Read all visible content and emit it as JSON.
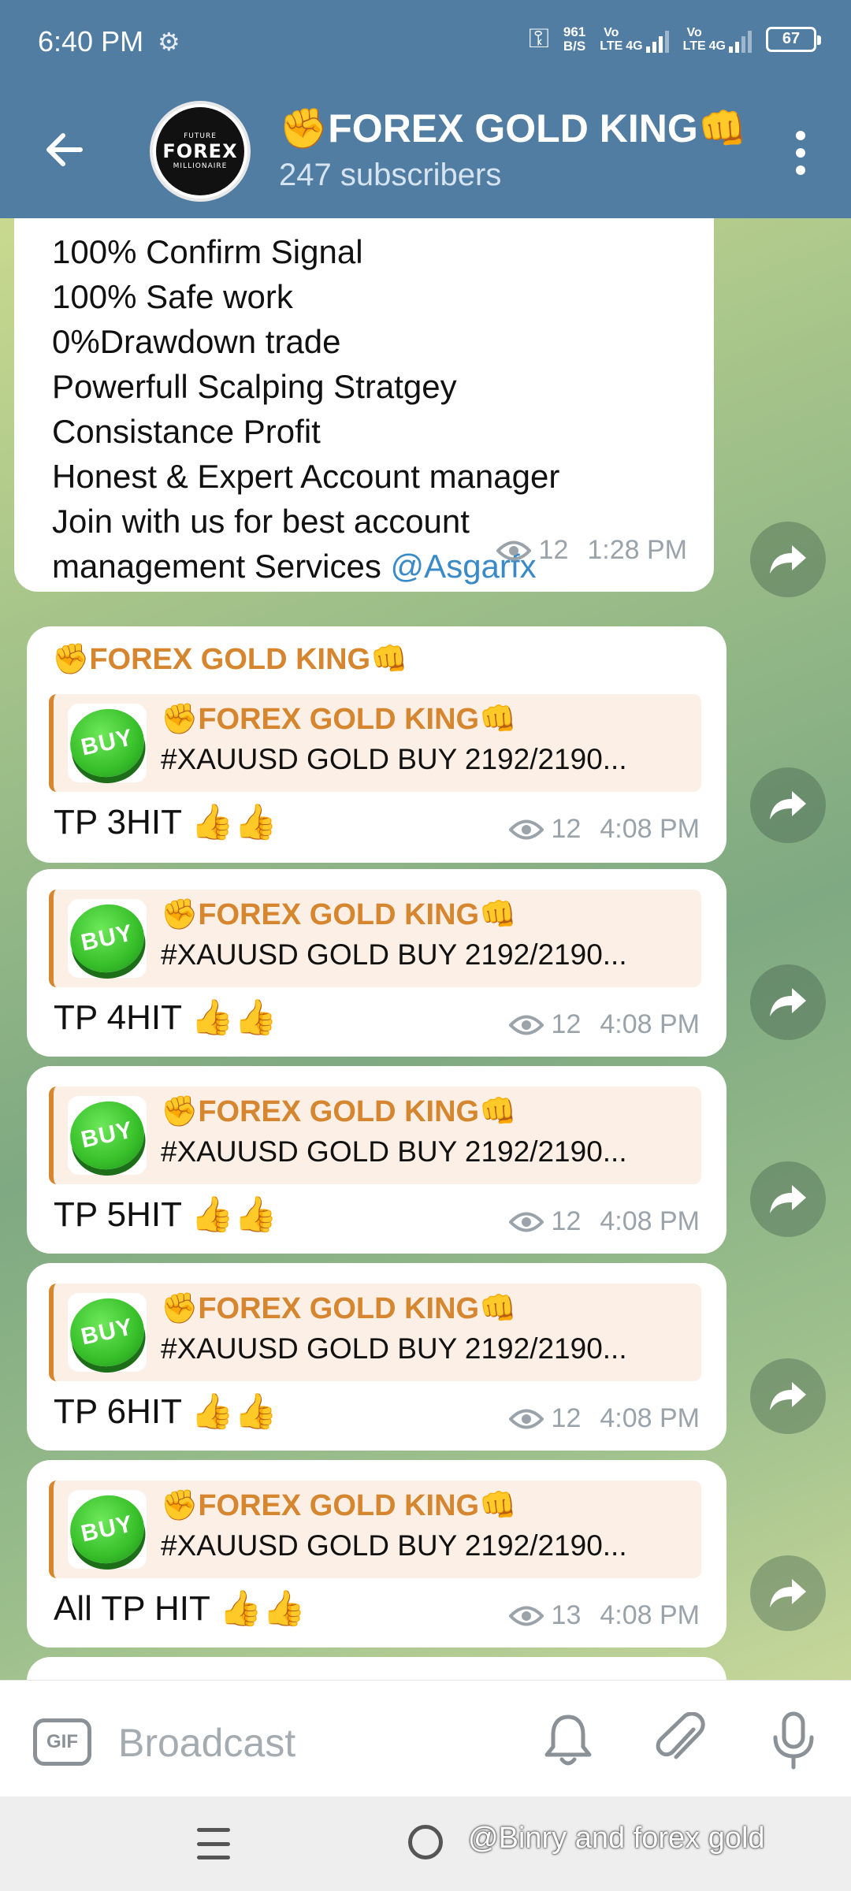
{
  "status_bar": {
    "time": "6:40 PM",
    "net_speed_value": "961",
    "net_speed_unit": "B/S",
    "sim1_label": "Vo\nLTE",
    "sim1_type": "4G",
    "sim2_label": "Vo\nLTE",
    "sim2_type": "4G",
    "battery": "67"
  },
  "header": {
    "title": "✊FOREX GOLD KING👊",
    "subscribers": "247 subscribers",
    "avatar_text_top": "FUTURE",
    "avatar_text_main": "FOREX",
    "avatar_text_bottom": "MILLIONAIRE"
  },
  "first_message": {
    "lines": [
      "100% Confirm Signal",
      "100% Safe work",
      "0%Drawdown trade",
      "Powerfull Scalping Stratgey",
      "Consistance Profit",
      "Honest & Expert Account manager",
      "Join with us for best account",
      "management Services "
    ],
    "mention": "@Asgarfx",
    "views": "12",
    "time": "1:28 PM"
  },
  "messages": [
    {
      "sender": "✊FOREX GOLD KING👊",
      "reply_thumb": "BUY",
      "reply_title": "✊FOREX GOLD KING👊",
      "reply_body": "#XAUUSD GOLD BUY    2192/2190...",
      "text": "TP 3HIT 👍👍",
      "views": "12",
      "time": "4:08 PM"
    },
    {
      "reply_thumb": "BUY",
      "reply_title": "✊FOREX GOLD KING👊",
      "reply_body": "#XAUUSD GOLD BUY    2192/2190...",
      "text": "TP 4HIT 👍👍",
      "views": "12",
      "time": "4:08 PM"
    },
    {
      "reply_thumb": "BUY",
      "reply_title": "✊FOREX GOLD KING👊",
      "reply_body": "#XAUUSD GOLD BUY    2192/2190...",
      "text": "TP 5HIT 👍👍",
      "views": "12",
      "time": "4:08 PM"
    },
    {
      "reply_thumb": "BUY",
      "reply_title": "✊FOREX GOLD KING👊",
      "reply_body": "#XAUUSD GOLD BUY    2192/2190...",
      "text": "TP 6HIT 👍👍",
      "views": "12",
      "time": "4:08 PM"
    },
    {
      "reply_thumb": "BUY",
      "reply_title": "✊FOREX GOLD KING👊",
      "reply_body": "#XAUUSD GOLD BUY    2192/2190...",
      "text": "All TP HIT 👍👍",
      "views": "13",
      "time": "4:08 PM"
    }
  ],
  "input_bar": {
    "gif_label": "GIF",
    "placeholder": "Broadcast"
  },
  "nav_bar": {
    "watermark": "@Binry and forex gold"
  },
  "colors": {
    "header_bg": "#517da2",
    "accent_orange": "#d6862e",
    "link_blue": "#3a8ac8",
    "meta_gray": "#9aa3aa"
  }
}
